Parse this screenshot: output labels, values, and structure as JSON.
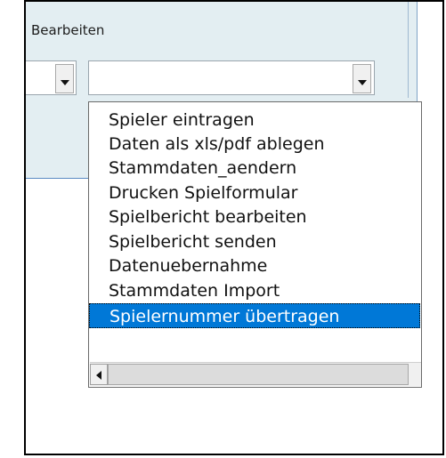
{
  "panel": {
    "title": "Bearbeiten"
  },
  "combo_left": {
    "value": ""
  },
  "combo_main": {
    "value": ""
  },
  "list": {
    "items": [
      {
        "label": "Spieler eintragen",
        "selected": false
      },
      {
        "label": "Daten als xls/pdf ablegen",
        "selected": false
      },
      {
        "label": "Stammdaten_aendern",
        "selected": false
      },
      {
        "label": "Drucken Spielformular",
        "selected": false
      },
      {
        "label": "Spielbericht bearbeiten",
        "selected": false
      },
      {
        "label": "Spielbericht senden",
        "selected": false
      },
      {
        "label": "Datenuebernahme",
        "selected": false
      },
      {
        "label": "Stammdaten Import",
        "selected": false
      },
      {
        "label": "Spielernummer übertragen",
        "selected": true
      }
    ]
  },
  "colors": {
    "panel_bg": "#e3eef2",
    "selection": "#0078d7"
  },
  "icons": {
    "dropdown": "chevron-down-icon",
    "scroll_left": "arrow-left-icon"
  }
}
